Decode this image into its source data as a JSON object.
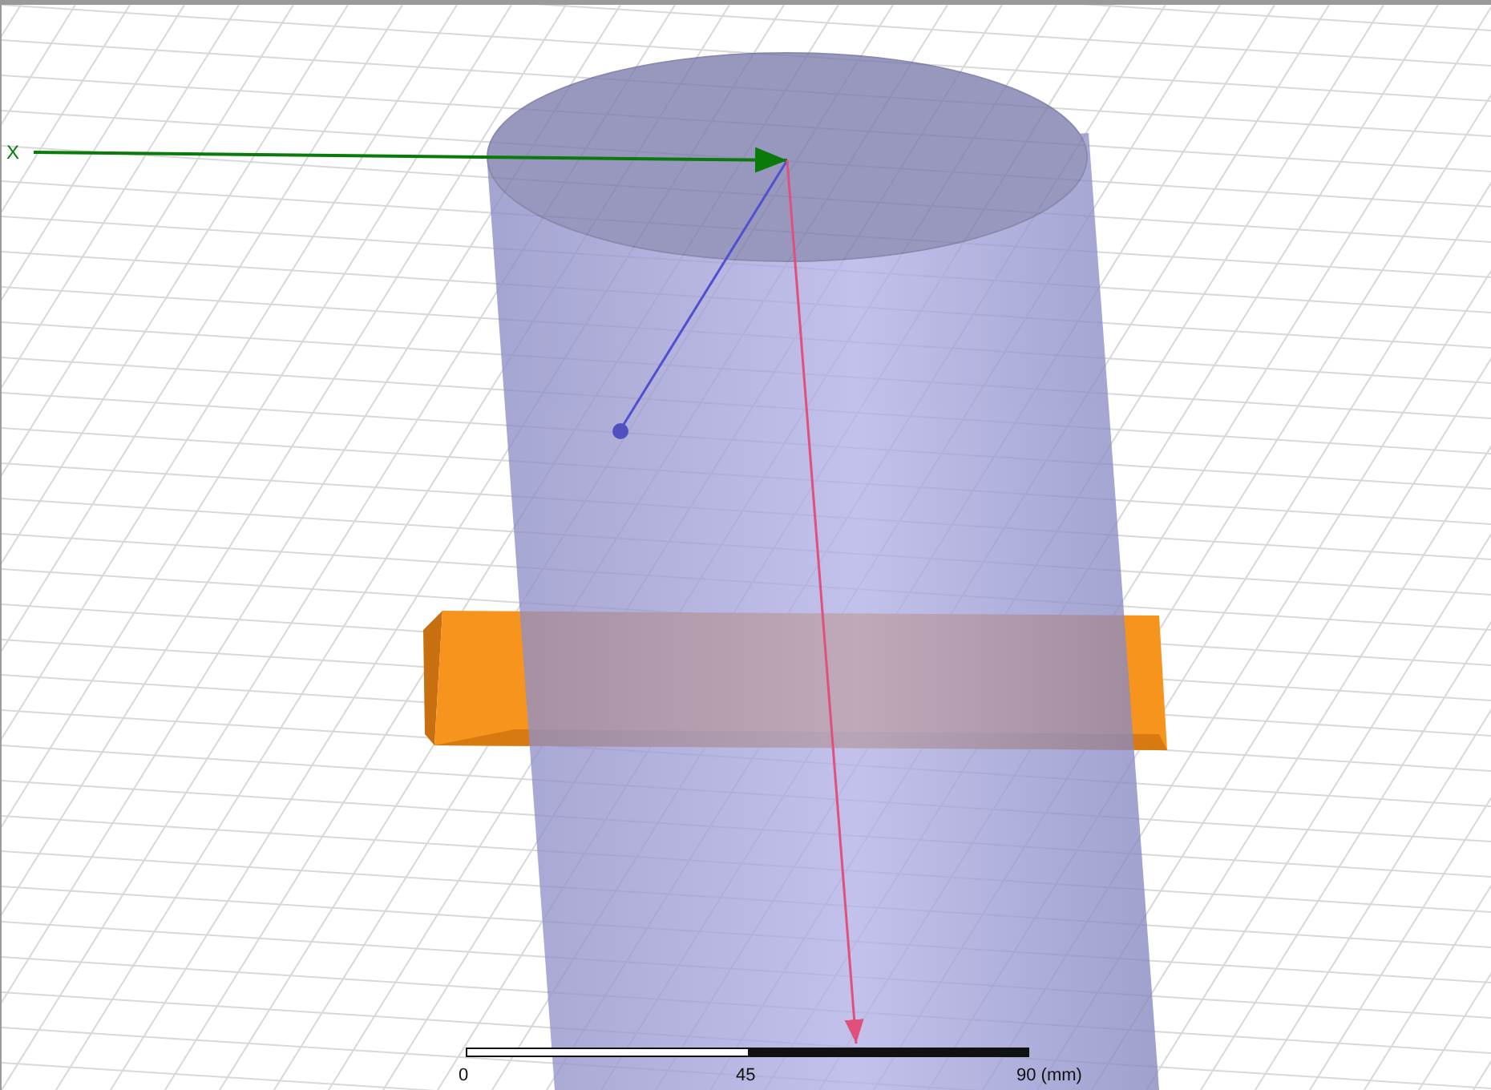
{
  "viewport": {
    "axis_label": "X"
  },
  "scale_bar": {
    "labels": [
      "0",
      "45",
      "90 (mm)"
    ]
  }
}
